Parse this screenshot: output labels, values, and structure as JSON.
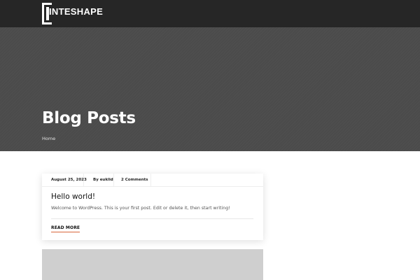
{
  "header": {
    "logo_text": "INTESHAPE"
  },
  "hero": {
    "title": "Blog Posts",
    "breadcrumb": "Home"
  },
  "post": {
    "date": "August 25, 2023",
    "author": "By euklid",
    "comments": "2 Comments",
    "title": "Hello world!",
    "excerpt": "Welcome to WordPress. This is your first post. Edit or delete it, then start writing!",
    "read_more": "READ MORE"
  },
  "colors": {
    "topbar": "#262626",
    "hero": "#4b4b4b",
    "accent": "#d9663a",
    "placeholder_image": "#cfcfcf"
  }
}
